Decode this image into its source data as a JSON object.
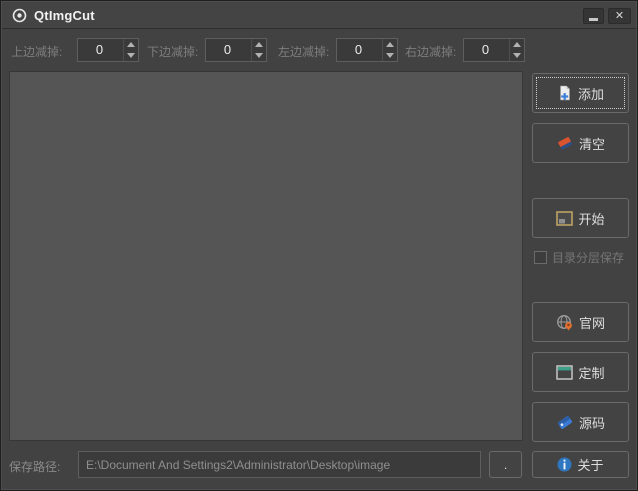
{
  "window": {
    "title": "QtImgCut",
    "close_glyph": "✕"
  },
  "colors": {
    "background": "#424242",
    "list_area": "#555555",
    "button_border": "#6a6a6a",
    "accent_blue": "#3d7fd8",
    "eraser_orange": "#d9532e",
    "eraser_blue": "#2d4f84",
    "frame_tan": "#bda264",
    "pin_orange": "#e07030",
    "window_teal": "#3fa08a",
    "info_blue": "#2e77c0"
  },
  "trim_controls": [
    {
      "label": "上边减掉:",
      "value": "0"
    },
    {
      "label": "下边减掉:",
      "value": "0"
    },
    {
      "label": "左边减掉:",
      "value": "0"
    },
    {
      "label": "右边减掉:",
      "value": "0"
    }
  ],
  "actions": {
    "add": "添加",
    "clear": "清空",
    "start": "开始",
    "layer_save_checkbox": "目录分层保存",
    "website": "官网",
    "custom": "定制",
    "source": "源码",
    "about": "关于"
  },
  "save_path": {
    "label": "保存路径:",
    "value": "E:\\Document And Settings2\\Administrator\\Desktop\\image",
    "browse_label": "."
  }
}
